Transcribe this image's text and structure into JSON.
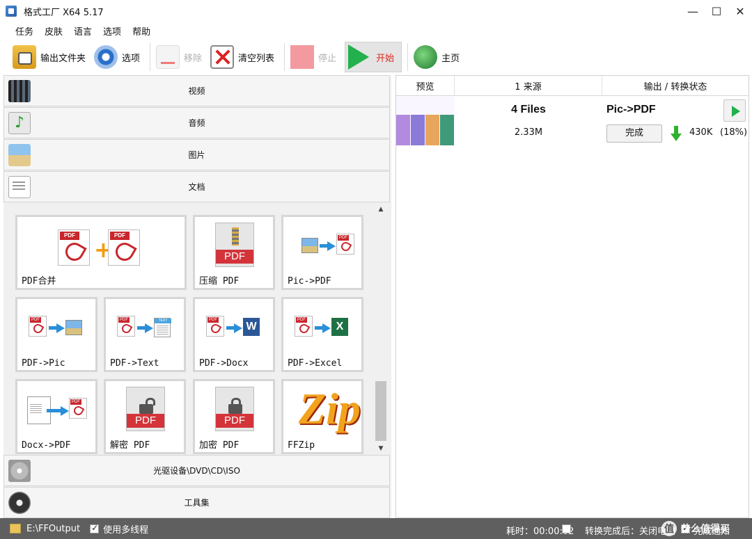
{
  "window": {
    "title": "格式工厂 X64 5.17",
    "minimize": "—",
    "maximize": "☐",
    "close": "✕"
  },
  "menu": [
    "任务",
    "皮肤",
    "语言",
    "选项",
    "帮助"
  ],
  "toolbar": {
    "output_folder": "输出文件夹",
    "options": "选项",
    "remove": "移除",
    "clear_list": "清空列表",
    "stop": "停止",
    "start": "开始",
    "home": "主页"
  },
  "categories": {
    "video": "视频",
    "audio": "音频",
    "picture": "图片",
    "document": "文档",
    "disc": "光驱设备\\DVD\\CD\\ISO",
    "tools": "工具集"
  },
  "tiles": {
    "pdf_merge": "PDF合并",
    "compress_pdf": "压缩 PDF",
    "pic_to_pdf": "Pic->PDF",
    "pdf_to_pic": "PDF->Pic",
    "pdf_to_text": "PDF->Text",
    "pdf_to_docx": "PDF->Docx",
    "pdf_to_excel": "PDF->Excel",
    "docx_to_pdf": "Docx->PDF",
    "decrypt_pdf": "解密 PDF",
    "encrypt_pdf": "加密 PDF",
    "ffzip": "FFZip"
  },
  "icons": {
    "pdf_tag": "PDF",
    "text_tag": "TEXT",
    "word_letter": "W",
    "excel_letter": "X",
    "zip_letters": "Zip"
  },
  "task_table": {
    "headers": {
      "preview": "预览",
      "source": "1 来源",
      "status": "输出 / 转换状态"
    },
    "rows": [
      {
        "source_name": "4 Files",
        "source_size": "2.33M",
        "output_type": "Pic->PDF",
        "status_button": "完成",
        "output_size": "430K",
        "percent": "(18%)"
      }
    ]
  },
  "statusbar": {
    "output_path": "E:\\FFOutput",
    "multithread_label": "使用多线程",
    "elapsed": "耗时：00:00:02",
    "after_convert": "转换完成后：关闭电脑",
    "notify": "完成通知",
    "watermark_icon": "值",
    "watermark_text": "什么值得买"
  },
  "colors": {
    "start_label": "#e0241b",
    "play_green": "#22b14c",
    "pdf_red": "#c8262c",
    "statusbar_bg": "#5f5f5f"
  }
}
